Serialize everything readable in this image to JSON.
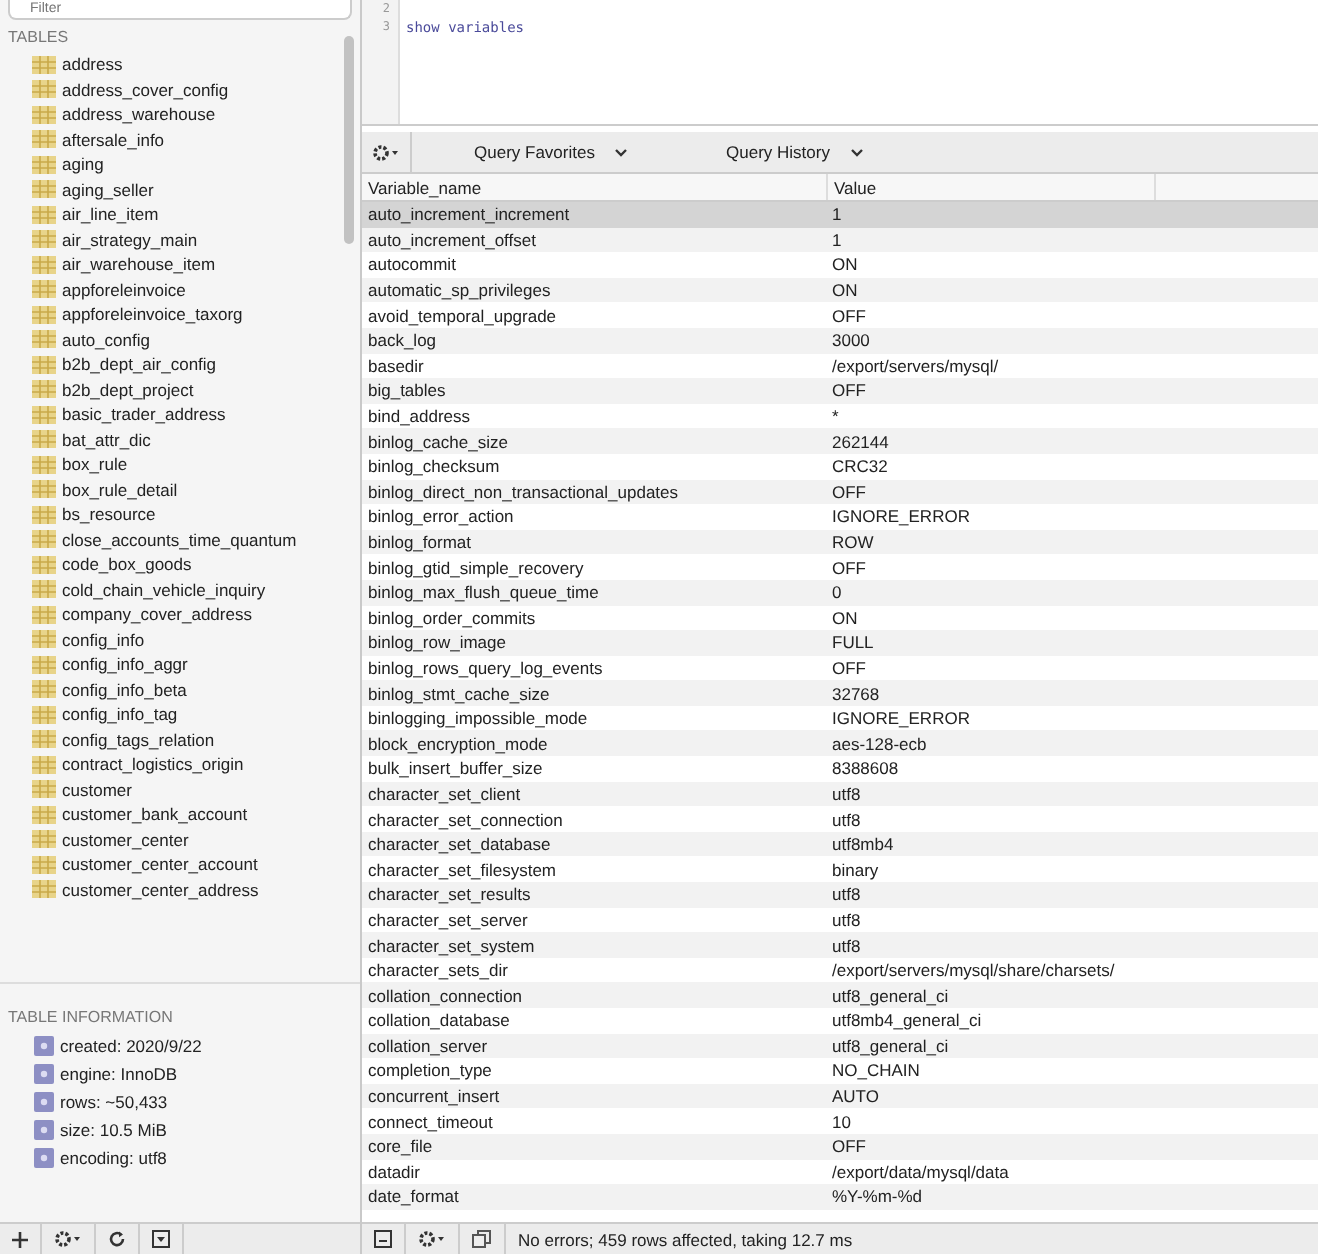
{
  "sidebar": {
    "filter": {
      "placeholder": "Filter"
    },
    "tables_heading": "TABLES",
    "tables": [
      "address",
      "address_cover_config",
      "address_warehouse",
      "aftersale_info",
      "aging",
      "aging_seller",
      "air_line_item",
      "air_strategy_main",
      "air_warehouse_item",
      "appforeleinvoice",
      "appforeleinvoice_taxorg",
      "auto_config",
      "b2b_dept_air_config",
      "b2b_dept_project",
      "basic_trader_address",
      "bat_attr_dic",
      "box_rule",
      "box_rule_detail",
      "bs_resource",
      "close_accounts_time_quantum",
      "code_box_goods",
      "cold_chain_vehicle_inquiry",
      "company_cover_address",
      "config_info",
      "config_info_aggr",
      "config_info_beta",
      "config_info_tag",
      "config_tags_relation",
      "contract_logistics_origin",
      "customer",
      "customer_bank_account",
      "customer_center",
      "customer_center_account",
      "customer_center_address"
    ],
    "info_heading": "TABLE INFORMATION",
    "info": [
      "created: 2020/9/22",
      "engine: InnoDB",
      "rows: ~50,433",
      "size: 10.5 MiB",
      "encoding: utf8"
    ]
  },
  "editor": {
    "lines": [
      {
        "number": "2"
      },
      {
        "number": "3",
        "text": "show variables"
      }
    ]
  },
  "results": {
    "toolbar": {
      "favorites": "Query Favorites",
      "history": "Query History"
    },
    "columns": [
      "Variable_name",
      "Value"
    ],
    "rows": [
      {
        "name": "auto_increment_increment",
        "value": "1",
        "selected": true
      },
      {
        "name": "auto_increment_offset",
        "value": "1",
        "selected": false
      },
      {
        "name": "autocommit",
        "value": "ON",
        "selected": false
      },
      {
        "name": "automatic_sp_privileges",
        "value": "ON",
        "selected": false
      },
      {
        "name": "avoid_temporal_upgrade",
        "value": "OFF",
        "selected": false
      },
      {
        "name": "back_log",
        "value": "3000",
        "selected": false
      },
      {
        "name": "basedir",
        "value": "/export/servers/mysql/",
        "selected": false
      },
      {
        "name": "big_tables",
        "value": "OFF",
        "selected": false
      },
      {
        "name": "bind_address",
        "value": "*",
        "selected": false
      },
      {
        "name": "binlog_cache_size",
        "value": "262144",
        "selected": false
      },
      {
        "name": "binlog_checksum",
        "value": "CRC32",
        "selected": false
      },
      {
        "name": "binlog_direct_non_transactional_updates",
        "value": "OFF",
        "selected": false
      },
      {
        "name": "binlog_error_action",
        "value": "IGNORE_ERROR",
        "selected": false
      },
      {
        "name": "binlog_format",
        "value": "ROW",
        "selected": false
      },
      {
        "name": "binlog_gtid_simple_recovery",
        "value": "OFF",
        "selected": false
      },
      {
        "name": "binlog_max_flush_queue_time",
        "value": "0",
        "selected": false
      },
      {
        "name": "binlog_order_commits",
        "value": "ON",
        "selected": false
      },
      {
        "name": "binlog_row_image",
        "value": "FULL",
        "selected": false
      },
      {
        "name": "binlog_rows_query_log_events",
        "value": "OFF",
        "selected": false
      },
      {
        "name": "binlog_stmt_cache_size",
        "value": "32768",
        "selected": false
      },
      {
        "name": "binlogging_impossible_mode",
        "value": "IGNORE_ERROR",
        "selected": false
      },
      {
        "name": "block_encryption_mode",
        "value": "aes-128-ecb",
        "selected": false
      },
      {
        "name": "bulk_insert_buffer_size",
        "value": "8388608",
        "selected": false
      },
      {
        "name": "character_set_client",
        "value": "utf8",
        "selected": false
      },
      {
        "name": "character_set_connection",
        "value": "utf8",
        "selected": false
      },
      {
        "name": "character_set_database",
        "value": "utf8mb4",
        "selected": false
      },
      {
        "name": "character_set_filesystem",
        "value": "binary",
        "selected": false
      },
      {
        "name": "character_set_results",
        "value": "utf8",
        "selected": false
      },
      {
        "name": "character_set_server",
        "value": "utf8",
        "selected": false
      },
      {
        "name": "character_set_system",
        "value": "utf8",
        "selected": false
      },
      {
        "name": "character_sets_dir",
        "value": "/export/servers/mysql/share/charsets/",
        "selected": false
      },
      {
        "name": "collation_connection",
        "value": "utf8_general_ci",
        "selected": false
      },
      {
        "name": "collation_database",
        "value": "utf8mb4_general_ci",
        "selected": false
      },
      {
        "name": "collation_server",
        "value": "utf8_general_ci",
        "selected": false
      },
      {
        "name": "completion_type",
        "value": "NO_CHAIN",
        "selected": false
      },
      {
        "name": "concurrent_insert",
        "value": "AUTO",
        "selected": false
      },
      {
        "name": "connect_timeout",
        "value": "10",
        "selected": false
      },
      {
        "name": "core_file",
        "value": "OFF",
        "selected": false
      },
      {
        "name": "datadir",
        "value": "/export/data/mysql/data",
        "selected": false
      },
      {
        "name": "date_format",
        "value": "%Y-%m-%d",
        "selected": false
      }
    ]
  },
  "status_bar": {
    "message": "No errors; 459 rows affected, taking 12.7 ms"
  }
}
